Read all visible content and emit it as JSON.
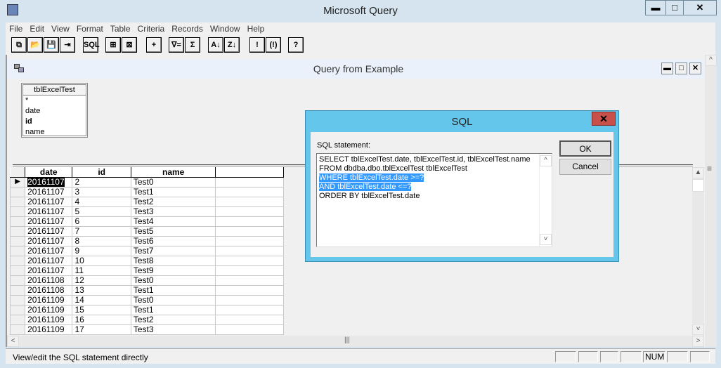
{
  "app": {
    "title": "Microsoft Query",
    "minimize": "▬",
    "maximize": "□",
    "close": "✕"
  },
  "menu": [
    "File",
    "Edit",
    "View",
    "Format",
    "Table",
    "Criteria",
    "Records",
    "Window",
    "Help"
  ],
  "toolbar": [
    {
      "name": "new-query",
      "glyph": "⧉"
    },
    {
      "name": "open-query",
      "glyph": "📂"
    },
    {
      "name": "save",
      "glyph": "💾"
    },
    {
      "name": "return-data",
      "glyph": "⇥"
    },
    {
      "name": "sql",
      "glyph": "SQL"
    },
    {
      "name": "show-tables",
      "glyph": "⊞"
    },
    {
      "name": "show-criteria",
      "glyph": "⊠"
    },
    {
      "name": "add-tables",
      "glyph": "+"
    },
    {
      "name": "criteria-equals",
      "glyph": "∇="
    },
    {
      "name": "cycle-totals",
      "glyph": "Σ"
    },
    {
      "name": "sort-ascending",
      "glyph": "A↓"
    },
    {
      "name": "sort-descending",
      "glyph": "Z↓"
    },
    {
      "name": "query-now",
      "glyph": "!"
    },
    {
      "name": "auto-query",
      "glyph": "(!)"
    },
    {
      "name": "help",
      "glyph": "?"
    }
  ],
  "child": {
    "title": "Query from Example",
    "minimize": "▬",
    "maximize": "□",
    "close": "✕"
  },
  "table_box": {
    "title": "tblExcelTest",
    "fields": [
      "*",
      "date",
      "id",
      "name"
    ]
  },
  "grid": {
    "columns": [
      "date",
      "id",
      "name",
      ""
    ],
    "rows": [
      [
        "20161107",
        "2",
        "Test0"
      ],
      [
        "20161107",
        "3",
        "Test1"
      ],
      [
        "20161107",
        "4",
        "Test2"
      ],
      [
        "20161107",
        "5",
        "Test3"
      ],
      [
        "20161107",
        "6",
        "Test4"
      ],
      [
        "20161107",
        "7",
        "Test5"
      ],
      [
        "20161107",
        "8",
        "Test6"
      ],
      [
        "20161107",
        "9",
        "Test7"
      ],
      [
        "20161107",
        "10",
        "Test8"
      ],
      [
        "20161107",
        "11",
        "Test9"
      ],
      [
        "20161108",
        "12",
        "Test0"
      ],
      [
        "20161108",
        "13",
        "Test1"
      ],
      [
        "20161109",
        "14",
        "Test0"
      ],
      [
        "20161109",
        "15",
        "Test1"
      ],
      [
        "20161109",
        "16",
        "Test2"
      ],
      [
        "20161109",
        "17",
        "Test3"
      ]
    ]
  },
  "status": {
    "text": "View/edit the SQL statement directly",
    "num": "NUM"
  },
  "dialog": {
    "title": "SQL",
    "close": "✕",
    "label": "SQL statement:",
    "ok": "OK",
    "cancel": "Cancel",
    "lines": [
      {
        "text": "SELECT tblExcelTest.date, tblExcelTest.id, tblExcelTest.name",
        "selected": false
      },
      {
        "text": "FROM dbdba.dbo.tblExcelTest tblExcelTest",
        "selected": false
      },
      {
        "text": "WHERE tblExcelTest.date >=?",
        "selected": true
      },
      {
        "text": "AND tblExcelTest.date <=?",
        "selected": true
      },
      {
        "text": "ORDER BY tblExcelTest.date",
        "selected": false
      }
    ]
  }
}
